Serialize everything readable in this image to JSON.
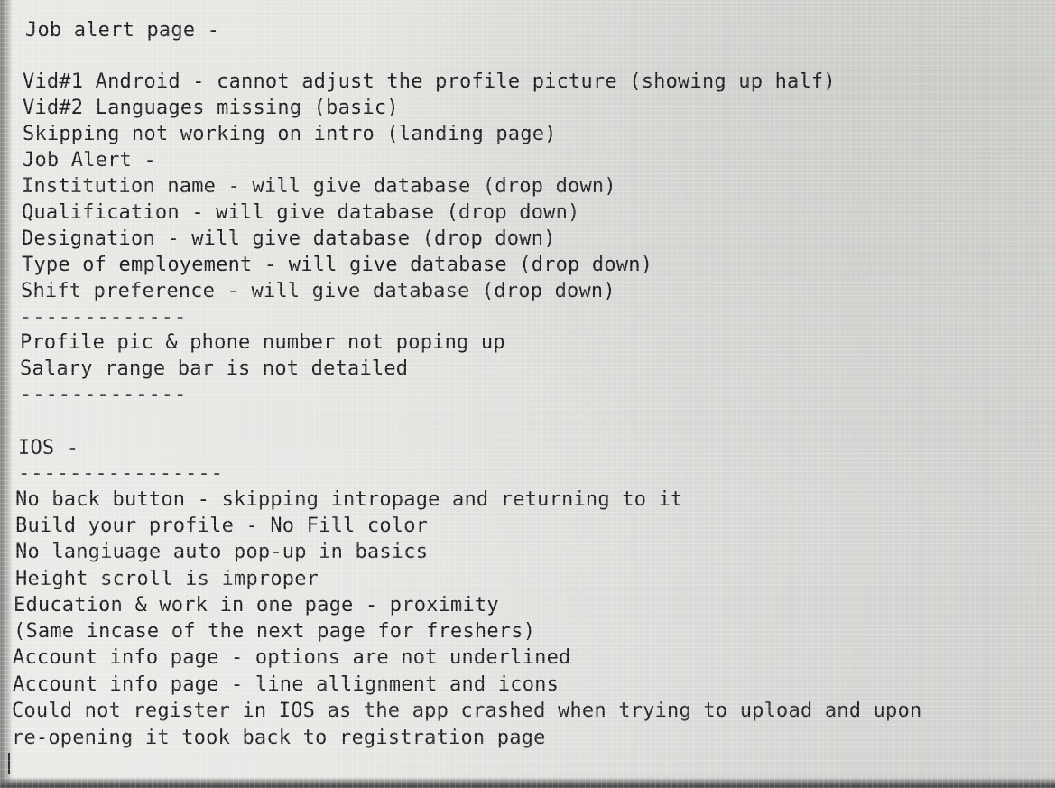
{
  "document": {
    "top_rule": "----------------",
    "heading": "Job alert page -",
    "android": [
      "Vid#1 Android - cannot adjust the profile picture (showing up half)",
      "Vid#2 Languages missing (basic)",
      "Skipping not working on intro (landing page)",
      "Job Alert -",
      "Institution name - will give database (drop down)",
      "Qualification - will give database (drop down)",
      "Designation - will give database (drop down)",
      "Type of employement - will give database (drop down)",
      "Shift preference - will give database (drop down)"
    ],
    "rule_1": "-------------",
    "profile_notes": [
      "Profile pic & phone number not poping up",
      "Salary range bar is not detailed"
    ],
    "rule_2": "-------------",
    "ios_heading": "IOS -",
    "rule_3": "----------------",
    "ios": [
      "No back button - skipping intropage and returning to it",
      "Build your profile - No Fill color",
      "No langiuage auto pop-up in basics",
      "Height scroll is improper",
      "Education & work in one page - proximity",
      "(Same incase of the next page for freshers)",
      "Account info page - options are not underlined",
      "Account info page - line allignment and icons",
      "Could not register in IOS as the app crashed when trying to upload and upon",
      "re-opening it took back to registration page"
    ]
  }
}
